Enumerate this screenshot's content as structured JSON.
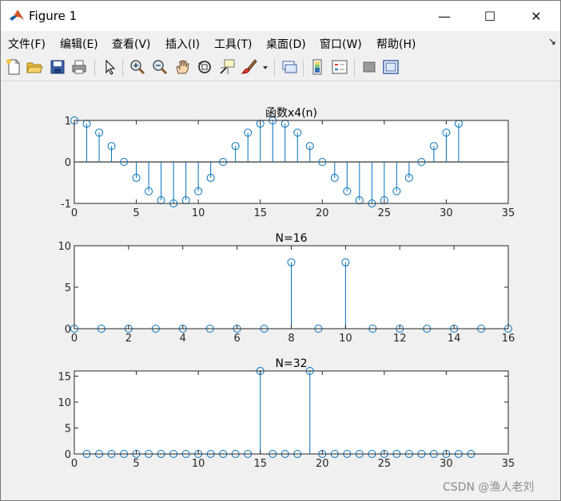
{
  "window": {
    "title": "Figure 1",
    "controls": {
      "minimize": "—",
      "maximize": "☐",
      "close": "✕"
    }
  },
  "menu": {
    "items": [
      "文件(F)",
      "编辑(E)",
      "查看(V)",
      "插入(I)",
      "工具(T)",
      "桌面(D)",
      "窗口(W)",
      "帮助(H)"
    ],
    "dock_arrow": "↘"
  },
  "toolbar": {
    "icons": [
      "new-figure-icon",
      "open-file-icon",
      "save-icon",
      "print-icon",
      "pointer-icon",
      "zoom-in-icon",
      "zoom-out-icon",
      "pan-hand-icon",
      "rotate-3d-icon",
      "data-cursor-icon",
      "brush-icon",
      "brush-dropdown-icon",
      "link-plot-icon",
      "colorbar-icon",
      "legend-icon",
      "hide-plot-tools-icon",
      "show-plot-tools-icon"
    ]
  },
  "colors": {
    "stem": "#0072bd",
    "axes_background": "#ffffff",
    "figure_background": "#f0f0f0"
  },
  "watermark": "CSDN @渔人老刘",
  "chart_data": [
    {
      "type": "stem",
      "title": "函数x4(n)",
      "x": [
        0,
        1,
        2,
        3,
        4,
        5,
        6,
        7,
        8,
        9,
        10,
        11,
        12,
        13,
        14,
        15,
        16,
        17,
        18,
        19,
        20,
        21,
        22,
        23,
        24,
        25,
        26,
        27,
        28,
        29,
        30,
        31
      ],
      "y": [
        1,
        0.924,
        0.707,
        0.383,
        0,
        -0.383,
        -0.707,
        -0.924,
        -1,
        -0.924,
        -0.707,
        -0.383,
        0,
        0.383,
        0.707,
        0.924,
        1,
        0.924,
        0.707,
        0.383,
        0,
        -0.383,
        -0.707,
        -0.924,
        -1,
        -0.924,
        -0.707,
        -0.383,
        0,
        0.383,
        0.707,
        0.924
      ],
      "xlim": [
        0,
        35
      ],
      "ylim": [
        -1,
        1
      ],
      "xticks": [
        0,
        5,
        10,
        15,
        20,
        25,
        30,
        35
      ],
      "yticks": [
        -1,
        0,
        1
      ]
    },
    {
      "type": "stem",
      "title": "N=16",
      "x": [
        0,
        1,
        2,
        3,
        4,
        5,
        6,
        7,
        8,
        9,
        10,
        11,
        12,
        13,
        14,
        15,
        16
      ],
      "y": [
        0,
        0,
        0,
        0,
        0,
        0,
        0,
        0,
        8,
        0,
        8,
        0,
        0,
        0,
        0,
        0,
        0
      ],
      "xlim": [
        0,
        16
      ],
      "ylim": [
        0,
        10
      ],
      "xticks": [
        0,
        2,
        4,
        6,
        8,
        10,
        12,
        14,
        16
      ],
      "yticks": [
        0,
        5,
        10
      ]
    },
    {
      "type": "stem",
      "title": "N=32",
      "x": [
        1,
        2,
        3,
        4,
        5,
        6,
        7,
        8,
        9,
        10,
        11,
        12,
        13,
        14,
        15,
        16,
        17,
        18,
        19,
        20,
        21,
        22,
        23,
        24,
        25,
        26,
        27,
        28,
        29,
        30,
        31,
        32
      ],
      "y": [
        0,
        0,
        0,
        0,
        0,
        0,
        0,
        0,
        0,
        0,
        0,
        0,
        0,
        0,
        16,
        0,
        0,
        0,
        16,
        0,
        0,
        0,
        0,
        0,
        0,
        0,
        0,
        0,
        0,
        0,
        0,
        0
      ],
      "xlim": [
        0,
        35
      ],
      "ylim": [
        0,
        16
      ],
      "xticks": [
        0,
        5,
        10,
        15,
        20,
        25,
        30,
        35
      ],
      "yticks": [
        0,
        5,
        10,
        15
      ]
    }
  ]
}
